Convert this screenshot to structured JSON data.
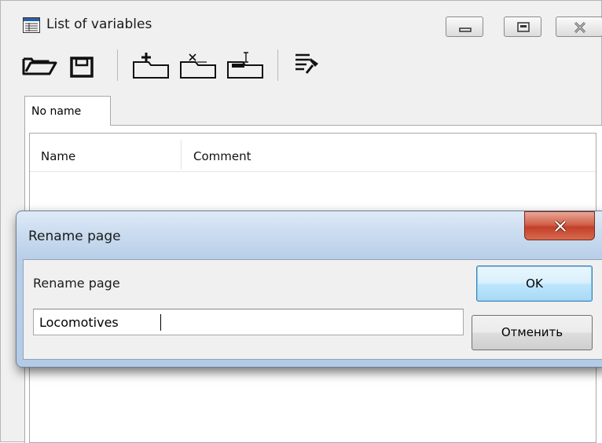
{
  "window": {
    "title": "List of variables",
    "app_icon": "list-window-icon",
    "controls": [
      "minimize-icon",
      "maximize-icon",
      "close-icon"
    ]
  },
  "toolbar": {
    "icons": [
      "open-folder-icon",
      "save-disk-icon",
      "add-page-icon",
      "delete-page-icon",
      "rename-page-icon",
      "pin-list-icon"
    ]
  },
  "tabs": [
    {
      "label": "No name",
      "active": true
    }
  ],
  "table": {
    "columns": [
      "Name",
      "Comment"
    ]
  },
  "dialog": {
    "title": "Rename page",
    "label": "Rename page",
    "input_value": "Locomotives",
    "ok_label": "OK",
    "cancel_label": "Отменить",
    "close_icon": "close-icon"
  },
  "colors": {
    "dialog_frame": "#b9cfe8",
    "close_button": "#c3402a",
    "ok_border": "#3c7fb1"
  }
}
